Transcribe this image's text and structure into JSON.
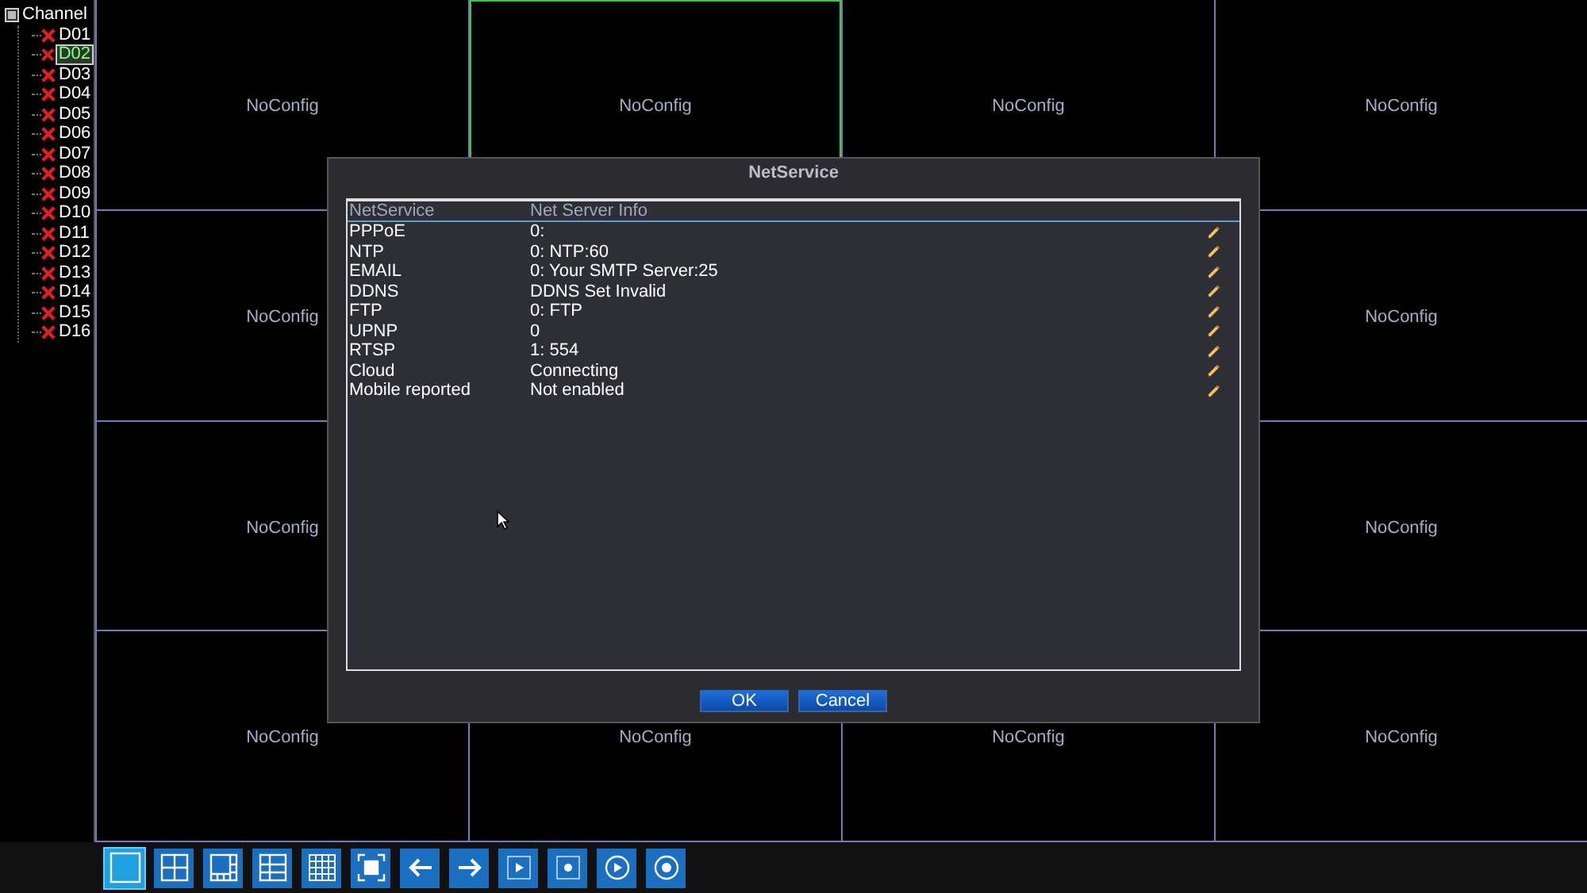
{
  "sidebar": {
    "title": "Channel",
    "expanded": true,
    "items": [
      {
        "label": "D01",
        "selected": false
      },
      {
        "label": "D02",
        "selected": true
      },
      {
        "label": "D03",
        "selected": false
      },
      {
        "label": "D04",
        "selected": false
      },
      {
        "label": "D05",
        "selected": false
      },
      {
        "label": "D06",
        "selected": false
      },
      {
        "label": "D07",
        "selected": false
      },
      {
        "label": "D08",
        "selected": false
      },
      {
        "label": "D09",
        "selected": false
      },
      {
        "label": "D10",
        "selected": false
      },
      {
        "label": "D11",
        "selected": false
      },
      {
        "label": "D12",
        "selected": false
      },
      {
        "label": "D13",
        "selected": false
      },
      {
        "label": "D14",
        "selected": false
      },
      {
        "label": "D15",
        "selected": false
      },
      {
        "label": "D16",
        "selected": false
      }
    ]
  },
  "grid": [
    {
      "cells": [
        {
          "label": "NoConfig",
          "selected": false
        },
        {
          "label": "NoConfig",
          "selected": true
        },
        {
          "label": "NoConfig",
          "selected": false
        },
        {
          "label": "NoConfig",
          "selected": false
        }
      ]
    },
    {
      "cells": [
        {
          "label": "NoConfig",
          "selected": false
        },
        {
          "label": "NoConfig",
          "selected": false
        }
      ]
    },
    {
      "cells": [
        {
          "label": "NoConfig",
          "selected": false
        },
        {
          "label": "NoConfig",
          "selected": false
        }
      ]
    },
    {
      "cells": [
        {
          "label": "NoConfig",
          "selected": false
        },
        {
          "label": "NoConfig",
          "selected": false
        },
        {
          "label": "NoConfig",
          "selected": false
        },
        {
          "label": "NoConfig",
          "selected": false
        }
      ]
    }
  ],
  "dialog": {
    "title": "NetService",
    "columns": [
      "NetService",
      "Net Server Info"
    ],
    "rows": [
      {
        "service": "PPPoE",
        "info": "0:"
      },
      {
        "service": "NTP",
        "info": "0: NTP:60"
      },
      {
        "service": "EMAIL",
        "info": "0: Your SMTP Server:25"
      },
      {
        "service": "DDNS",
        "info": "DDNS Set Invalid"
      },
      {
        "service": "FTP",
        "info": "0: FTP"
      },
      {
        "service": "UPNP",
        "info": "0"
      },
      {
        "service": "RTSP",
        "info": "1: 554"
      },
      {
        "service": "Cloud",
        "info": "Connecting"
      },
      {
        "service": "Mobile reported",
        "info": "Not enabled"
      }
    ],
    "buttons": [
      "OK",
      "Cancel"
    ]
  },
  "toolbar": [
    {
      "kind": "single",
      "selected": true
    },
    {
      "kind": "quad",
      "selected": false
    },
    {
      "kind": "eight",
      "selected": false
    },
    {
      "kind": "nine",
      "selected": false
    },
    {
      "kind": "sixteen",
      "selected": false
    },
    {
      "kind": "fullscreen",
      "selected": false
    },
    {
      "kind": "prev",
      "selected": false
    },
    {
      "kind": "next",
      "selected": false
    },
    {
      "kind": "play",
      "selected": false
    },
    {
      "kind": "record",
      "selected": false
    },
    {
      "kind": "playcircle",
      "selected": false
    },
    {
      "kind": "recordcircle",
      "selected": false
    }
  ]
}
